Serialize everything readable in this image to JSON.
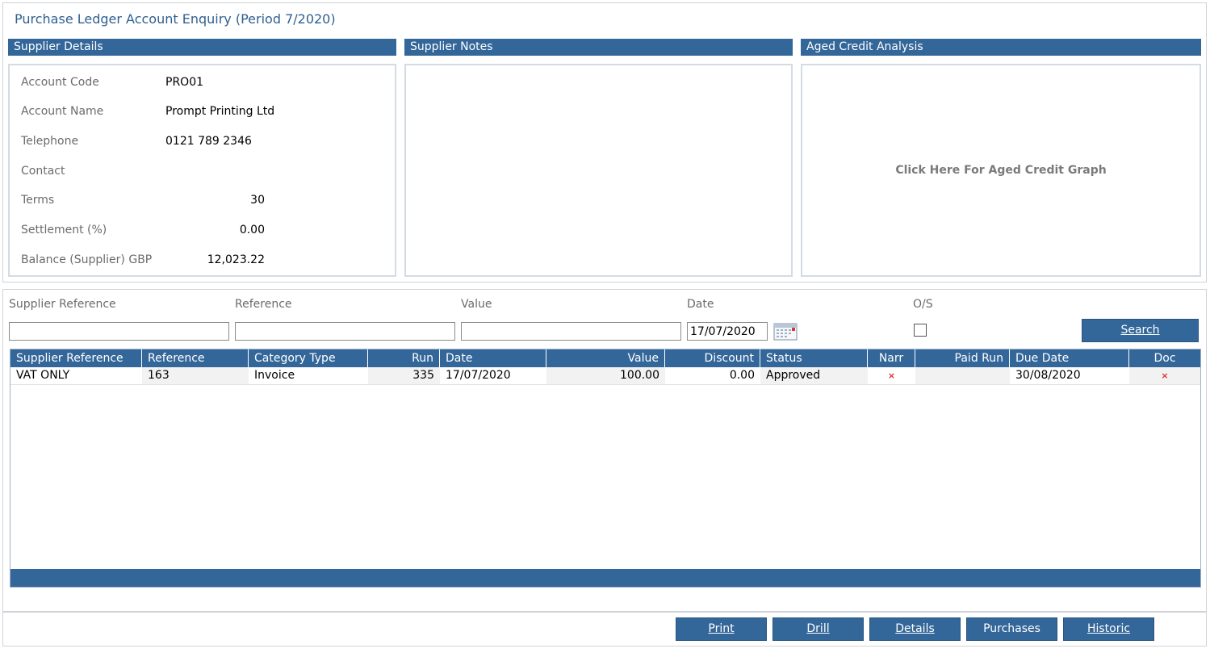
{
  "title": "Purchase Ledger Account Enquiry (Period  7/2020)",
  "sections": {
    "supplier_details": "Supplier Details",
    "supplier_notes": "Supplier Notes",
    "aged_credit": "Aged Credit Analysis"
  },
  "details": {
    "account_code_label": "Account Code",
    "account_code": "PRO01",
    "account_name_label": "Account Name",
    "account_name": "Prompt Printing Ltd",
    "telephone_label": "Telephone",
    "telephone": "0121 789 2346",
    "contact_label": "Contact",
    "contact": "",
    "terms_label": "Terms",
    "terms": "30",
    "settlement_label": "Settlement (%)",
    "settlement": "0.00",
    "balance_label": "Balance (Supplier) GBP",
    "balance": "12,023.22"
  },
  "aged_credit_link": "Click Here For Aged Credit Graph",
  "filters": {
    "supplier_reference_label": "Supplier Reference",
    "reference_label": "Reference",
    "value_label": "Value",
    "date_label": "Date",
    "os_label": "O/S",
    "supplier_reference": "",
    "reference": "",
    "value": "",
    "date": "17/07/2020",
    "search_label": "Search"
  },
  "grid": {
    "columns": [
      "Supplier Reference",
      "Reference",
      "Category Type",
      "Run",
      "Date",
      "Value",
      "Discount",
      "Status",
      "Narr",
      "Paid Run",
      "Due Date",
      "Doc"
    ],
    "rows": [
      {
        "supplier_reference": "VAT ONLY",
        "reference": "163",
        "category_type": "Invoice",
        "run": "335",
        "date": "17/07/2020",
        "value": "100.00",
        "discount": "0.00",
        "status": "Approved",
        "narr": "×",
        "paid_run": "",
        "due_date": "30/08/2020",
        "doc": "×"
      }
    ]
  },
  "buttons": {
    "print": "Print",
    "drill": "Drill",
    "details": "Details",
    "purchases": "Purchases",
    "historic": "Historic"
  },
  "colors": {
    "header_blue": "#336699",
    "title_blue": "#2f5f8f",
    "x_red": "#e03030"
  }
}
